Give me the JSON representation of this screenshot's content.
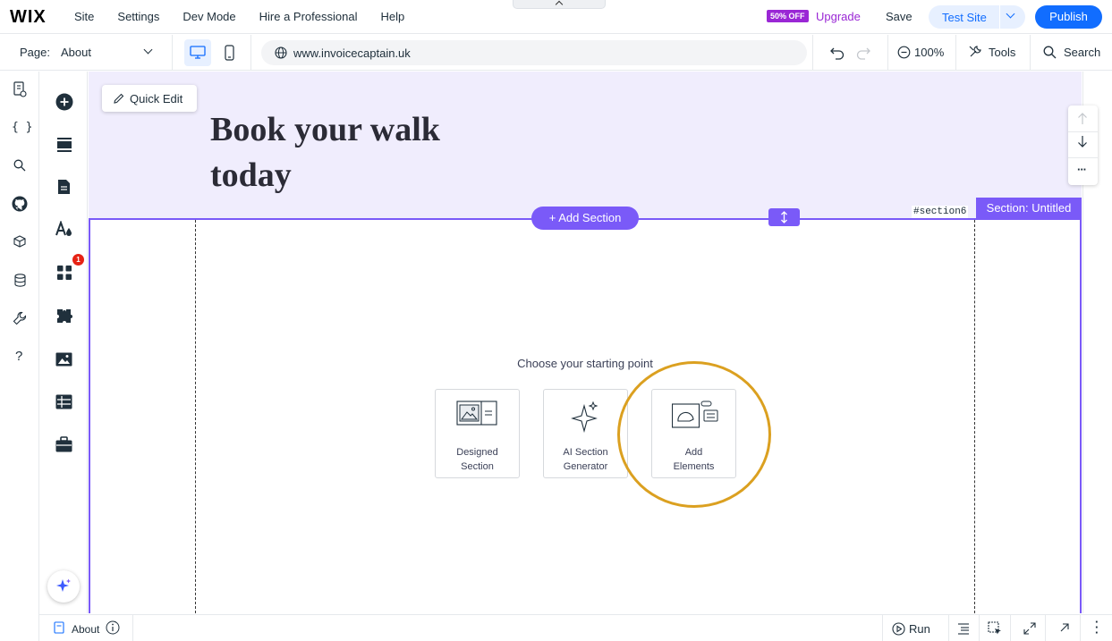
{
  "topbar": {
    "logo": "WIX",
    "nav": [
      "Site",
      "Settings",
      "Dev Mode",
      "Hire a Professional",
      "Help"
    ],
    "promo_badge": "50% OFF",
    "upgrade_label": "Upgrade",
    "save_label": "Save",
    "test_site_label": "Test Site",
    "publish_label": "Publish"
  },
  "toolbar": {
    "page_label": "Page:",
    "page_value": "About",
    "url": "www.invoicecaptain.uk",
    "zoom": "100%",
    "tools_label": "Tools",
    "search_label": "Search"
  },
  "left_rail": {
    "icons": [
      "pages-icon",
      "code-icon",
      "search-icon",
      "github-icon",
      "package-icon",
      "database-icon",
      "wrench-icon",
      "help-icon"
    ],
    "panel_icons": [
      "add-icon",
      "sections-icon",
      "page-icon",
      "design-icon",
      "apps-icon",
      "plugins-icon",
      "media-icon",
      "table-icon",
      "briefcase-icon"
    ],
    "apps_badge": "1"
  },
  "canvas": {
    "hero_title": "Book your walk today",
    "quick_edit_label": "Quick Edit",
    "add_section_label": "+ Add Section",
    "section_anchor": "#section6",
    "section_label": "Section: Untitled",
    "choose_heading": "Choose your starting point",
    "options": [
      {
        "line1": "Designed",
        "line2": "Section"
      },
      {
        "line1": "AI Section",
        "line2": "Generator"
      },
      {
        "line1": "Add",
        "line2": "Elements"
      }
    ]
  },
  "bottombar": {
    "page_name": "About",
    "run_label": "Run"
  },
  "colors": {
    "accent_blue": "#116dff",
    "selection_purple": "#7a5af8",
    "upgrade_purple": "#9a27d5",
    "highlight_gold": "#dba020",
    "hero_bg": "#f0edfd"
  }
}
